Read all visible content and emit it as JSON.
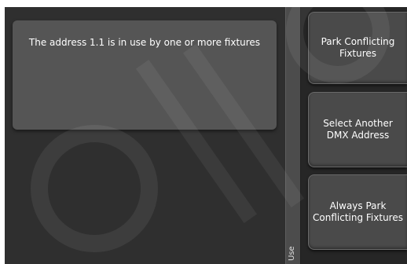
{
  "dialog": {
    "message": "The address 1.1 is in use by one or more fixtures"
  },
  "side_strip": {
    "label": "Use"
  },
  "softkeys": [
    {
      "label": "Park Conflicting Fixtures"
    },
    {
      "label": "Select Another DMX Address"
    },
    {
      "label": "Always Park Conflicting Fixtures"
    }
  ],
  "colors": {
    "panel_background": "#2f2f2f",
    "message_box": "#555555",
    "softkey": "#4a4a4a",
    "text": "#ffffff"
  }
}
